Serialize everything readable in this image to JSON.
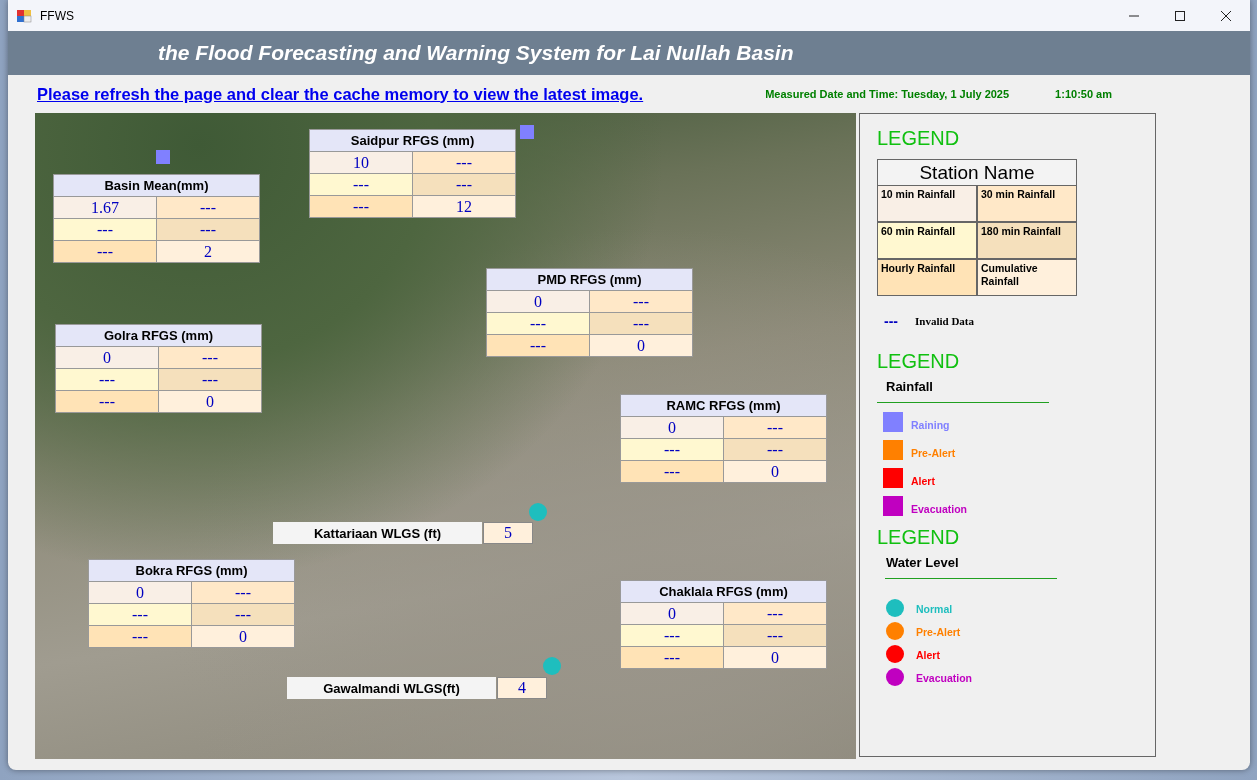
{
  "window": {
    "title": "FFWS"
  },
  "header": {
    "title": "the Flood Forecasting and Warning System for Lai Nullah Basin"
  },
  "notice": {
    "text": "Please refresh the page and clear the cache memory to view the latest image."
  },
  "measured": {
    "label": "Measured Date and Time: Tuesday, 1 July 2025",
    "time": "1:10:50 am"
  },
  "map": {
    "markers": [
      {
        "kind": "rain",
        "color": "#8080ff"
      },
      {
        "kind": "rain",
        "color": "#8080ff"
      },
      {
        "kind": "level",
        "color": "#1ebebe"
      },
      {
        "kind": "level",
        "color": "#1ebebe"
      }
    ],
    "stations": [
      {
        "kind": "table",
        "name": "Basin Mean(mm)",
        "values": [
          "1.67",
          "---",
          "---",
          "---",
          "---",
          "2"
        ]
      },
      {
        "kind": "table",
        "name": "Saidpur RFGS (mm)",
        "values": [
          "10",
          "---",
          "---",
          "---",
          "---",
          "12"
        ]
      },
      {
        "kind": "table",
        "name": "PMD RFGS (mm)",
        "values": [
          "0",
          "---",
          "---",
          "---",
          "---",
          "0"
        ]
      },
      {
        "kind": "table",
        "name": "Golra RFGS (mm)",
        "values": [
          "0",
          "---",
          "---",
          "---",
          "---",
          "0"
        ]
      },
      {
        "kind": "table",
        "name": "RAMC RFGS (mm)",
        "values": [
          "0",
          "---",
          "---",
          "---",
          "---",
          "0"
        ]
      },
      {
        "kind": "gauge",
        "name": "Kattariaan WLGS (ft)",
        "value": "5"
      },
      {
        "kind": "table",
        "name": "Bokra RFGS (mm)",
        "values": [
          "0",
          "---",
          "---",
          "---",
          "---",
          "0"
        ]
      },
      {
        "kind": "table",
        "name": "Chaklala RFGS (mm)",
        "values": [
          "0",
          "---",
          "---",
          "---",
          "---",
          "0"
        ]
      },
      {
        "kind": "gauge",
        "name": "Gawalmandi WLGS(ft)",
        "value": "4"
      }
    ]
  },
  "legend": {
    "title": "LEGEND",
    "key_table": {
      "title": "Station Name",
      "cells": [
        "10 min Rainfall",
        "30 min Rainfall",
        "60 min Rainfall",
        "180 min Rainfall",
        "Hourly Rainfall",
        "Cumulative Rainfall"
      ]
    },
    "invalid": {
      "symbol": "---",
      "text": "Invalid Data"
    }
  },
  "rainfall_legend": {
    "title": "LEGEND",
    "subtitle": "Rainfall",
    "items": [
      {
        "label": "Raining",
        "color": "#8080ff"
      },
      {
        "label": "Pre-Alert",
        "color": "#ff8000"
      },
      {
        "label": "Alert",
        "color": "#ff0000"
      },
      {
        "label": "Evacuation",
        "color": "#c000c0"
      }
    ]
  },
  "water_level_legend": {
    "title": "LEGEND",
    "subtitle": "Water Level",
    "items": [
      {
        "label": "Normal",
        "color": "#1ebebe"
      },
      {
        "label": "Pre-Alert",
        "color": "#ff8000"
      },
      {
        "label": "Alert",
        "color": "#ff0000"
      },
      {
        "label": "Evacuation",
        "color": "#c000c0"
      }
    ]
  }
}
